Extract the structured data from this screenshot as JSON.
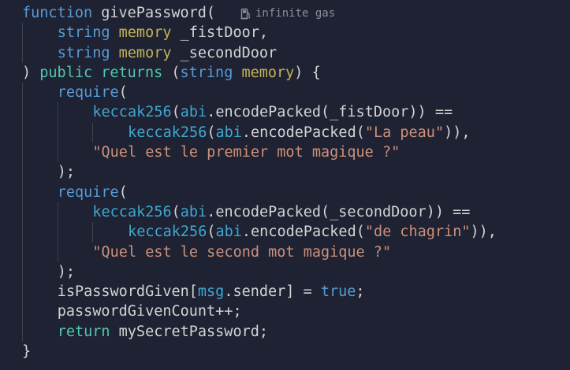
{
  "gas_hint": {
    "icon": "gas-pump-icon",
    "text": "infinite gas"
  },
  "colors": {
    "background": "#1e2233",
    "keyword_blue": "#569cd6",
    "keyword_green": "#4ec9b0",
    "modifier": "#c4b455",
    "function_name": "#dcdcaa",
    "builtin": "#3fa7d0",
    "string": "#ce9178",
    "default": "#d4d4d4"
  },
  "lines": [
    {
      "indent": 0,
      "tokens": [
        [
          "function",
          "kw-blue"
        ],
        [
          " ",
          "default"
        ],
        [
          "givePassword",
          "default"
        ],
        [
          "(",
          "punct"
        ]
      ]
    },
    {
      "indent": 1,
      "tokens": [
        [
          "string",
          "kw-blue"
        ],
        [
          " ",
          "default"
        ],
        [
          "memory",
          "mod"
        ],
        [
          " ",
          "default"
        ],
        [
          "_fistDoor",
          "default"
        ],
        [
          ",",
          "punct"
        ]
      ]
    },
    {
      "indent": 1,
      "tokens": [
        [
          "string",
          "kw-blue"
        ],
        [
          " ",
          "default"
        ],
        [
          "memory",
          "mod"
        ],
        [
          " ",
          "default"
        ],
        [
          "_secondDoor",
          "default"
        ]
      ]
    },
    {
      "indent": 0,
      "tokens": [
        [
          ")",
          "punct"
        ],
        [
          " ",
          "default"
        ],
        [
          "public",
          "kw-green"
        ],
        [
          " ",
          "default"
        ],
        [
          "returns",
          "kw-green"
        ],
        [
          " ",
          "default"
        ],
        [
          "(",
          "punct"
        ],
        [
          "string",
          "kw-blue"
        ],
        [
          " ",
          "default"
        ],
        [
          "memory",
          "mod"
        ],
        [
          ")",
          "punct"
        ],
        [
          " ",
          "default"
        ],
        [
          "{",
          "punct"
        ]
      ]
    },
    {
      "indent": 1,
      "tokens": [
        [
          "require",
          "kw-blue"
        ],
        [
          "(",
          "punct"
        ]
      ]
    },
    {
      "indent": 2,
      "tokens": [
        [
          "keccak256",
          "builtin"
        ],
        [
          "(",
          "punct"
        ],
        [
          "abi",
          "builtin"
        ],
        [
          ".",
          "punct"
        ],
        [
          "encodePacked",
          "default"
        ],
        [
          "(",
          "punct"
        ],
        [
          "_fistDoor",
          "default"
        ],
        [
          ")",
          "punct"
        ],
        [
          ")",
          "punct"
        ],
        [
          " ",
          "default"
        ],
        [
          "==",
          "punct"
        ]
      ]
    },
    {
      "indent": 3,
      "tokens": [
        [
          "keccak256",
          "builtin"
        ],
        [
          "(",
          "punct"
        ],
        [
          "abi",
          "builtin"
        ],
        [
          ".",
          "punct"
        ],
        [
          "encodePacked",
          "default"
        ],
        [
          "(",
          "punct"
        ],
        [
          "\"La peau\"",
          "str"
        ],
        [
          ")",
          "punct"
        ],
        [
          ")",
          "punct"
        ],
        [
          ",",
          "punct"
        ]
      ]
    },
    {
      "indent": 2,
      "tokens": [
        [
          "\"Quel est le premier mot magique ?\"",
          "str"
        ]
      ]
    },
    {
      "indent": 1,
      "tokens": [
        [
          ")",
          "punct"
        ],
        [
          ";",
          "punct"
        ]
      ]
    },
    {
      "indent": 1,
      "tokens": [
        [
          "require",
          "kw-blue"
        ],
        [
          "(",
          "punct"
        ]
      ]
    },
    {
      "indent": 2,
      "tokens": [
        [
          "keccak256",
          "builtin"
        ],
        [
          "(",
          "punct"
        ],
        [
          "abi",
          "builtin"
        ],
        [
          ".",
          "punct"
        ],
        [
          "encodePacked",
          "default"
        ],
        [
          "(",
          "punct"
        ],
        [
          "_secondDoor",
          "default"
        ],
        [
          ")",
          "punct"
        ],
        [
          ")",
          "punct"
        ],
        [
          " ",
          "default"
        ],
        [
          "==",
          "punct"
        ]
      ]
    },
    {
      "indent": 3,
      "tokens": [
        [
          "keccak256",
          "builtin"
        ],
        [
          "(",
          "punct"
        ],
        [
          "abi",
          "builtin"
        ],
        [
          ".",
          "punct"
        ],
        [
          "encodePacked",
          "default"
        ],
        [
          "(",
          "punct"
        ],
        [
          "\"de chagrin\"",
          "str"
        ],
        [
          ")",
          "punct"
        ],
        [
          ")",
          "punct"
        ],
        [
          ",",
          "punct"
        ]
      ]
    },
    {
      "indent": 2,
      "tokens": [
        [
          "\"Quel est le second mot magique ?\"",
          "str"
        ]
      ]
    },
    {
      "indent": 1,
      "tokens": [
        [
          ")",
          "punct"
        ],
        [
          ";",
          "punct"
        ]
      ]
    },
    {
      "indent": 1,
      "tokens": [
        [
          "isPasswordGiven",
          "default"
        ],
        [
          "[",
          "punct"
        ],
        [
          "msg",
          "builtin"
        ],
        [
          ".",
          "punct"
        ],
        [
          "sender",
          "default"
        ],
        [
          "]",
          "punct"
        ],
        [
          " ",
          "default"
        ],
        [
          "=",
          "punct"
        ],
        [
          " ",
          "default"
        ],
        [
          "true",
          "kw-blue"
        ],
        [
          ";",
          "punct"
        ]
      ]
    },
    {
      "indent": 1,
      "tokens": [
        [
          "passwordGivenCount",
          "default"
        ],
        [
          "++",
          "punct"
        ],
        [
          ";",
          "punct"
        ]
      ]
    },
    {
      "indent": 1,
      "tokens": [
        [
          "return",
          "kw-green"
        ],
        [
          " ",
          "default"
        ],
        [
          "mySecretPassword",
          "default"
        ],
        [
          ";",
          "punct"
        ]
      ]
    },
    {
      "indent": 0,
      "tokens": [
        [
          "}",
          "punct"
        ]
      ]
    }
  ]
}
